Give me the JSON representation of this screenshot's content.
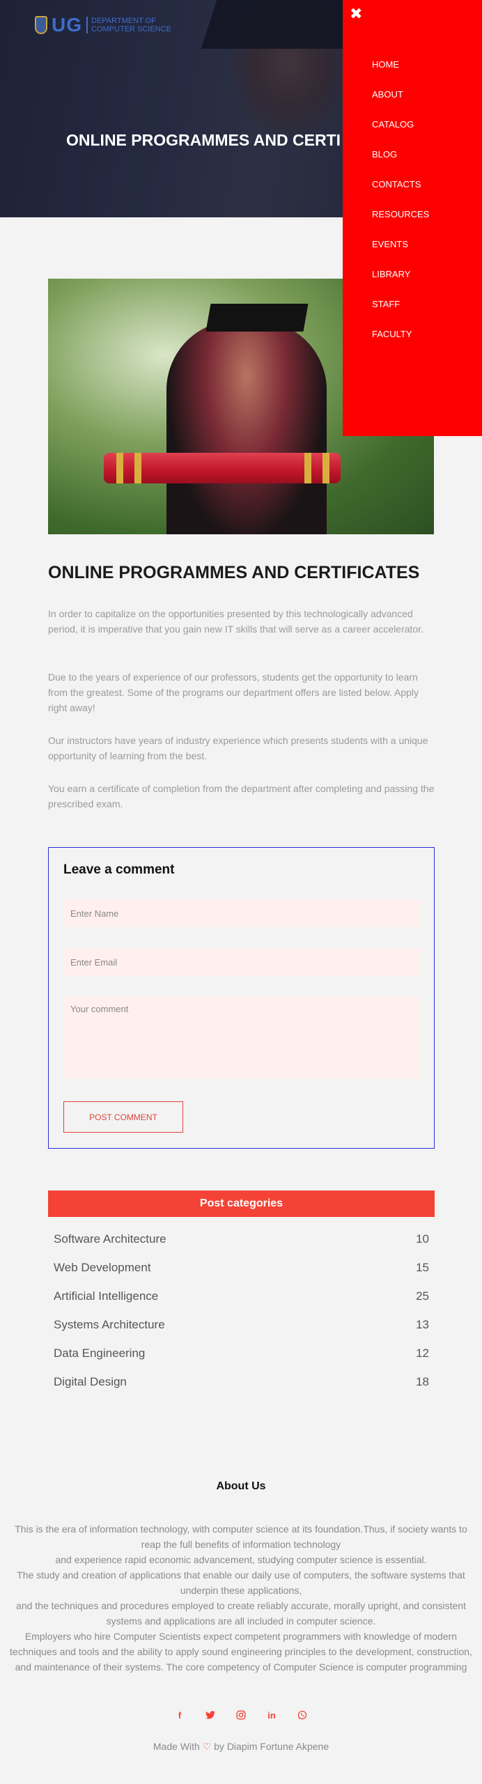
{
  "header": {
    "logo_text": "UG",
    "logo_dept_line1": "DEPARTMENT OF",
    "logo_dept_line2": "COMPUTER SCIENCE",
    "hero_title": "ONLINE PROGRAMMES AND CERTI"
  },
  "nav": {
    "close_glyph": "✖",
    "items": [
      "HOME",
      "ABOUT",
      "CATALOG",
      "BLOG",
      "CONTACTS",
      "RESOURCES",
      "EVENTS",
      "LIBRARY",
      "STAFF",
      "FACULTY"
    ]
  },
  "article": {
    "title": "ONLINE PROGRAMMES AND CERTIFICATES",
    "paragraphs": [
      "In order to capitalize on the opportunities presented by this technologically advanced period, it is imperative that you gain new IT skills that will serve as a career accelerator.",
      "Due to the years of experience of our professors, students get the opportunity to learn from the greatest. Some of the programs our department offers are listed below. Apply right away!",
      "Our instructors have years of industry experience which presents students with a unique opportunity of learning from the best.",
      "You earn a certificate of completion from the department after completing and passing the prescribed exam."
    ]
  },
  "comment_form": {
    "heading": "Leave a comment",
    "name_placeholder": "Enter Name",
    "email_placeholder": "Enter Email",
    "comment_placeholder": "Your comment",
    "submit_label": "POST COMMENT"
  },
  "categories": {
    "heading": "Post categories",
    "items": [
      {
        "name": "Software Architecture",
        "count": "10"
      },
      {
        "name": "Web Development",
        "count": "15"
      },
      {
        "name": "Artificial Intelligence",
        "count": "25"
      },
      {
        "name": "Systems Architecture",
        "count": "13"
      },
      {
        "name": "Data Engineering",
        "count": "12"
      },
      {
        "name": "Digital Design",
        "count": "18"
      }
    ]
  },
  "footer": {
    "about_title": "About Us",
    "about_lines": [
      "This is the era of information technology, with computer science at its foundation.Thus, if society wants to reap the full benefits of information technology",
      "and experience rapid economic advancement, studying computer science is essential.",
      "The study and creation of applications that enable our daily use of computers, the software systems that underpin these applications,",
      "and the techniques and procedures employed to create reliably accurate, morally upright, and consistent systems and applications are all included in computer science.",
      "Employers who hire Computer Scientists expect competent programmers with knowledge of modern techniques and tools and the ability to apply sound engineering principles to the development, construction, and maintenance of their systems. The core competency of Computer Science is computer programming"
    ],
    "socials": [
      {
        "icon": "facebook-icon",
        "glyph": "f"
      },
      {
        "icon": "twitter-icon",
        "glyph": "🐦"
      },
      {
        "icon": "instagram-icon",
        "glyph": "◎"
      },
      {
        "icon": "linkedin-icon",
        "glyph": "in"
      },
      {
        "icon": "whatsapp-icon",
        "glyph": "✆"
      }
    ],
    "made_prefix": "Made With",
    "made_heart": "♡",
    "made_suffix": "by Diapim Fortune Akpene"
  },
  "colors": {
    "nav_bg": "#ff0000",
    "accent": "#f44336",
    "form_border": "#2b2bd9",
    "field_bg": "#fff0ee"
  }
}
